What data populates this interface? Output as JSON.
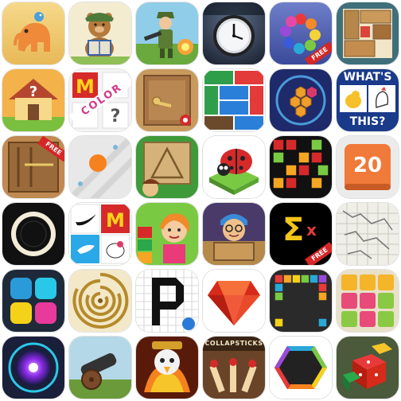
{
  "icons": [
    {
      "id": "elephant",
      "badge": ""
    },
    {
      "id": "teddy-bear-reading",
      "badge": ""
    },
    {
      "id": "soldier-farm",
      "badge": ""
    },
    {
      "id": "wall-clock",
      "badge": ""
    },
    {
      "id": "hexagon-color-ring",
      "badge": "FREE"
    },
    {
      "id": "sliding-block-puzzle",
      "badge": ""
    },
    {
      "id": "question-house",
      "badge": ""
    },
    {
      "id": "color-logo-quiz",
      "badge": "",
      "text": "COLOR"
    },
    {
      "id": "wooden-door",
      "badge": ""
    },
    {
      "id": "color-blocks",
      "badge": ""
    },
    {
      "id": "hex-block-puzzle",
      "badge": ""
    },
    {
      "id": "whats-this-quiz",
      "badge": "",
      "text_top": "WHAT'S",
      "text_bottom": "THIS?"
    },
    {
      "id": "wooden-box-lines",
      "badge": "FREE"
    },
    {
      "id": "orange-ball-lines",
      "badge": ""
    },
    {
      "id": "triangle-puzzle",
      "badge": ""
    },
    {
      "id": "ladybug",
      "badge": ""
    },
    {
      "id": "colored-block-grid",
      "badge": ""
    },
    {
      "id": "number-20-tile",
      "badge": "",
      "number": "20"
    },
    {
      "id": "ring-circle",
      "badge": ""
    },
    {
      "id": "brand-logo-quiz",
      "badge": ""
    },
    {
      "id": "candy-girl",
      "badge": ""
    },
    {
      "id": "boy-with-glasses",
      "badge": ""
    },
    {
      "id": "sigma-x-math",
      "badge": "FREE",
      "text": "Σ",
      "sub": "x"
    },
    {
      "id": "paper-map-grid",
      "badge": ""
    },
    {
      "id": "four-color-squares",
      "badge": ""
    },
    {
      "id": "golden-maze",
      "badge": ""
    },
    {
      "id": "pixel-letter-p",
      "badge": ""
    },
    {
      "id": "red-gem",
      "badge": ""
    },
    {
      "id": "block-fill-grid",
      "badge": ""
    },
    {
      "id": "nine-square-grid",
      "badge": ""
    },
    {
      "id": "purple-orb",
      "badge": ""
    },
    {
      "id": "cannon",
      "badge": ""
    },
    {
      "id": "flaming-bird",
      "badge": ""
    },
    {
      "id": "collapsticks",
      "badge": "",
      "text": "COLLAPSTICKS"
    },
    {
      "id": "hexagon-outline",
      "badge": ""
    },
    {
      "id": "3d-dice",
      "badge": ""
    }
  ],
  "colors": {
    "free_badge": "#d62626",
    "page_background": "#ffffff"
  }
}
